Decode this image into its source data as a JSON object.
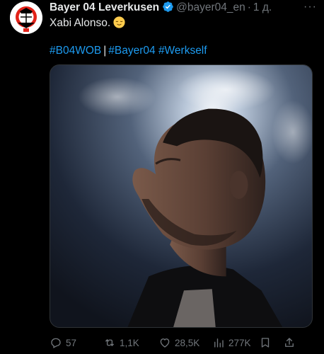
{
  "tweet": {
    "display_name": "Bayer 04 Leverkusen",
    "handle": "@bayer04_en",
    "separator": "·",
    "time": "1 д.",
    "text": "Xabi Alonso.",
    "hashtags": [
      "#B04WOB",
      "#Bayer04",
      "#Werkself"
    ],
    "hashtag_separator": "|"
  },
  "logo": {
    "top_text": "BAYER",
    "ring_text": "Leverkusen",
    "badge": "04"
  },
  "actions": {
    "replies": "57",
    "retweets": "1,1K",
    "likes": "28,5K",
    "views": "277K"
  },
  "colors": {
    "background": "#000000",
    "text": "#e7e9ea",
    "muted": "#71767b",
    "link": "#1d9bf0",
    "verified": "#1d9bf0",
    "club_red": "#e32219"
  },
  "icons": {
    "verified": "verified-badge-icon",
    "more": "more-icon",
    "emoji": "relieved-face-emoji",
    "reply": "reply-icon",
    "retweet": "retweet-icon",
    "like": "heart-icon",
    "views": "views-icon",
    "bookmark": "bookmark-icon",
    "share": "share-icon"
  }
}
